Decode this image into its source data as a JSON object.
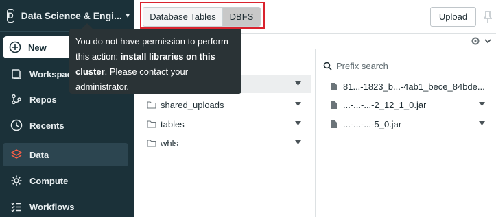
{
  "sidebar": {
    "workspace_badge": "D",
    "workspace_name": "Data Science & Engi...",
    "new_label": "New",
    "items": [
      {
        "label": "Workspace",
        "icon": "workspace-icon"
      },
      {
        "label": "Repos",
        "icon": "repos-icon"
      },
      {
        "label": "Recents",
        "icon": "clock-icon"
      },
      {
        "label": "Data",
        "icon": "data-icon",
        "active": true
      },
      {
        "label": "Compute",
        "icon": "compute-icon"
      },
      {
        "label": "Workflows",
        "icon": "workflows-icon"
      }
    ],
    "active_color": "#ff5f46"
  },
  "tabs": [
    {
      "label": "Database Tables"
    },
    {
      "label": "DBFS",
      "selected": true
    }
  ],
  "toolbar": {
    "upload_label": "Upload"
  },
  "folders": [
    {
      "name": "",
      "selected": true
    },
    {
      "name": "shared_uploads"
    },
    {
      "name": "tables"
    },
    {
      "name": "whls"
    }
  ],
  "files": {
    "search_placeholder": "Prefix search",
    "items": [
      {
        "name": "81...-1823_b...-4ab1_bece_84bde..."
      },
      {
        "name": "...-...-...-2_12_1_0.jar"
      },
      {
        "name": "...-...-...-5_0.jar"
      }
    ]
  },
  "tooltip": {
    "text_before": "You do not have permission to perform this action: ",
    "bold_action": "install libraries on this cluster",
    "text_after": ". Please contact your administrator."
  }
}
